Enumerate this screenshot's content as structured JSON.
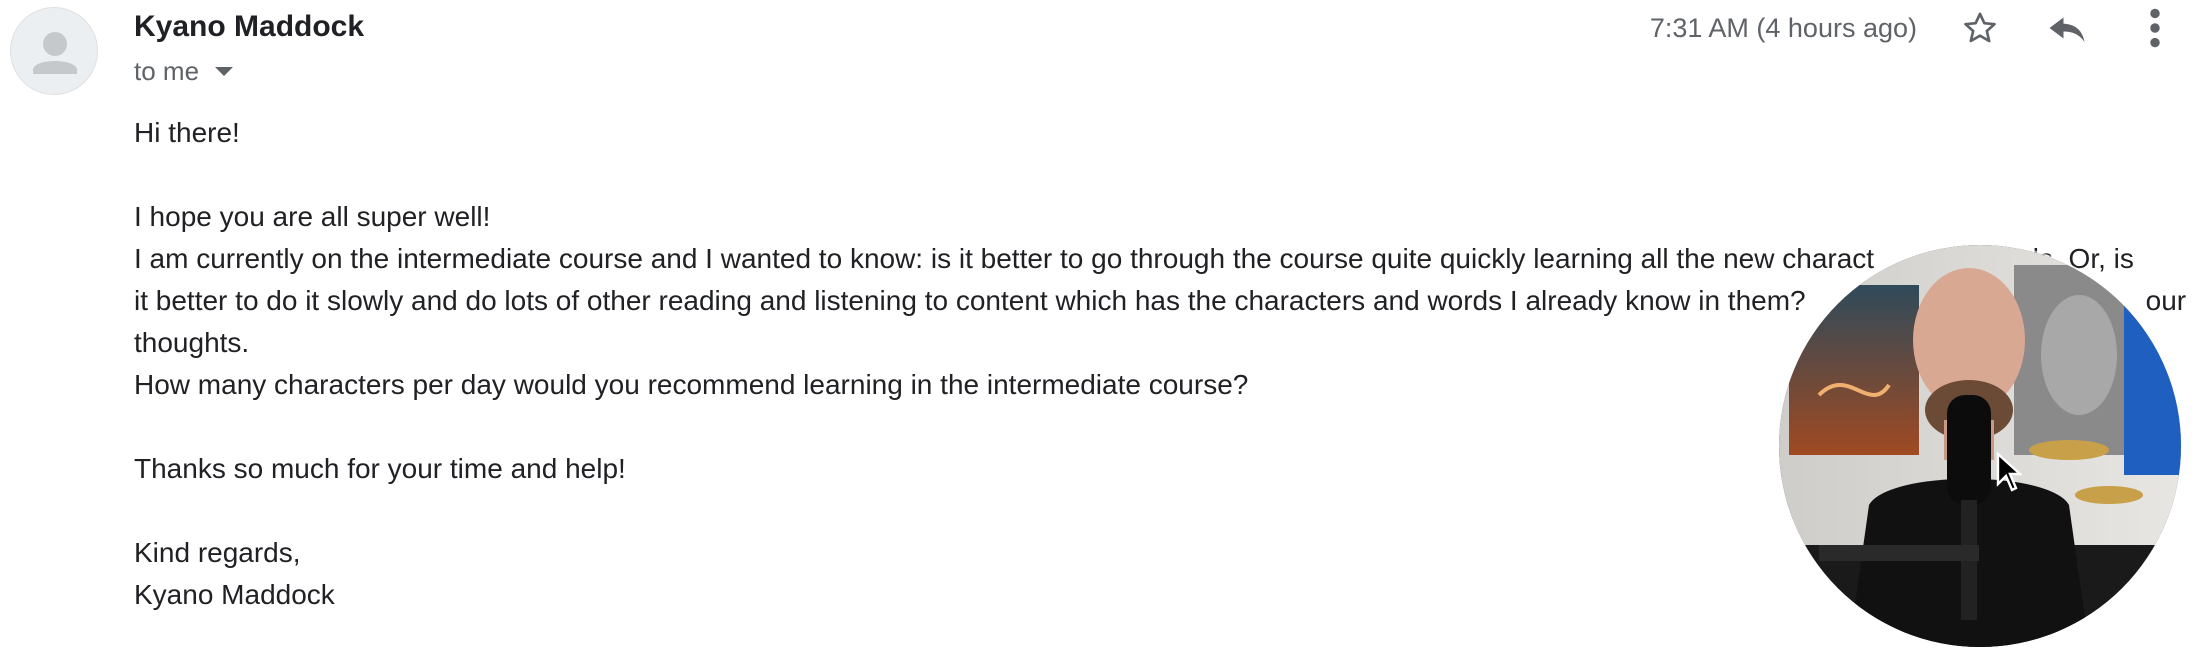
{
  "email": {
    "sender_name": "Kyano Maddock",
    "recipient_label": "to me",
    "time": "7:31 AM (4 hours ago)",
    "icons": {
      "avatar": "person-avatar-icon",
      "star": "star-icon",
      "reply": "reply-icon",
      "more": "more-vert-icon",
      "recipient_toggle": "caret-down-icon"
    },
    "body": {
      "greeting": "Hi there!",
      "line1": "I hope you are all super well!",
      "line2": "I am currently on the intermediate course and I wanted to know: is it better to go through the course quite quickly learning all the new charact",
      "line2_end": "rds. Or, is",
      "line3": "it better to do it slowly and do lots of other reading and listening to content which has the characters and words I already know in them?",
      "line3_end": "our",
      "line4": "thoughts.",
      "line5": "How many characters per day would you recommend learning in the intermediate course?",
      "thanks": "Thanks so much for your time and help!",
      "signoff": "Kind regards,",
      "signature": "Kyano Maddock"
    }
  },
  "colors": {
    "text_primary": "#202124",
    "text_secondary": "#5f6368",
    "icon": "#5f6368"
  }
}
